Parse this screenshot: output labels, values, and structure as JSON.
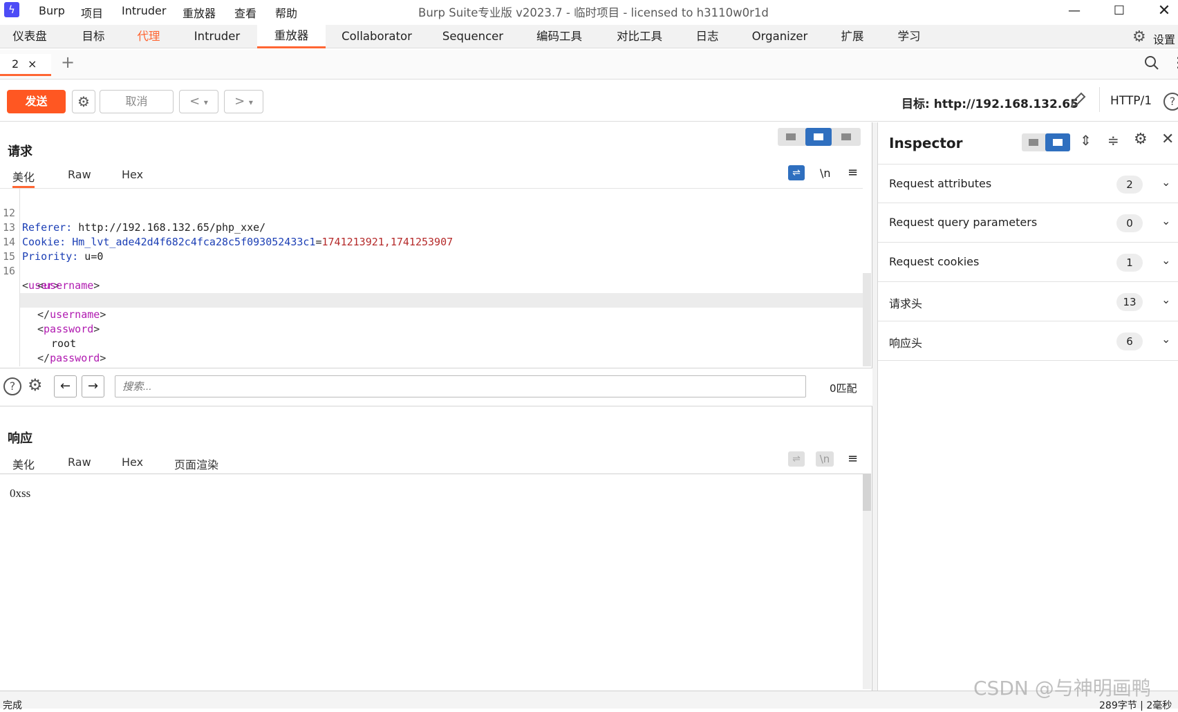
{
  "window": {
    "menu": [
      "Burp",
      "项目",
      "Intruder",
      "重放器",
      "查看",
      "帮助"
    ],
    "title": "Burp Suite专业版  v2023.7 - 临时项目 - licensed to h3110w0r1d"
  },
  "main_tabs": [
    "仪表盘",
    "目标",
    "代理",
    "Intruder",
    "重放器",
    "Collaborator",
    "Sequencer",
    "编码工具",
    "对比工具",
    "日志",
    "Organizer",
    "扩展",
    "学习"
  ],
  "settings_label": "设置",
  "repeater_tab": {
    "label": "2",
    "close": "×",
    "add": "+"
  },
  "toolbar": {
    "send": "发送",
    "cancel": "取消",
    "back": "<",
    "forward": ">",
    "dropdown": "▾",
    "target": "目标: http://192.168.132.65",
    "http_version": "HTTP/1"
  },
  "request": {
    "title": "请求",
    "tabs": [
      "美化",
      "Raw",
      "Hex"
    ],
    "newline_toggle": "\\n",
    "lines": [
      {
        "n": "12",
        "name": "Referer:",
        "value": " http://192.168.132.65/php_xxe/"
      },
      {
        "n": "13",
        "name": "Cookie:",
        "cookie_name": " Hm_lvt_ade42d4f682c4fca28c5f093052433c1",
        "eq": "=",
        "cookie_value": "1741213921,1741253907"
      },
      {
        "n": "14",
        "name": "Priority:",
        "value": " u=0"
      },
      {
        "n": "15"
      },
      {
        "n": "16",
        "open": "<",
        "tag": "user",
        "close": ">"
      }
    ],
    "xml": {
      "username_tag": "username",
      "username_value": "xss",
      "password_tag": "password",
      "password_value": "root",
      "user_tag": "user"
    }
  },
  "search": {
    "placeholder": "搜索...",
    "matches": "0匹配"
  },
  "response": {
    "title": "响应",
    "tabs": [
      "美化",
      "Raw",
      "Hex",
      "页面渲染"
    ],
    "newline_toggle": "\\n",
    "rendered_text": "0xss"
  },
  "inspector": {
    "title": "Inspector",
    "rows": [
      {
        "label": "Request attributes",
        "count": "2"
      },
      {
        "label": "Request query parameters",
        "count": "0"
      },
      {
        "label": "Request cookies",
        "count": "1"
      },
      {
        "label": "请求头",
        "count": "13"
      },
      {
        "label": "响应头",
        "count": "6"
      }
    ]
  },
  "status": {
    "left": "完成",
    "right": "289字节 | 2毫秒"
  },
  "watermark": "CSDN @与神明画鸭",
  "colors": {
    "accent": "#ff6633",
    "send_button": "#ff5722",
    "layout_active": "#2f6fbf",
    "header_name": "#1c3fb5",
    "cookie_value": "#b52a2a",
    "xml_tag": "#b01ab0"
  }
}
